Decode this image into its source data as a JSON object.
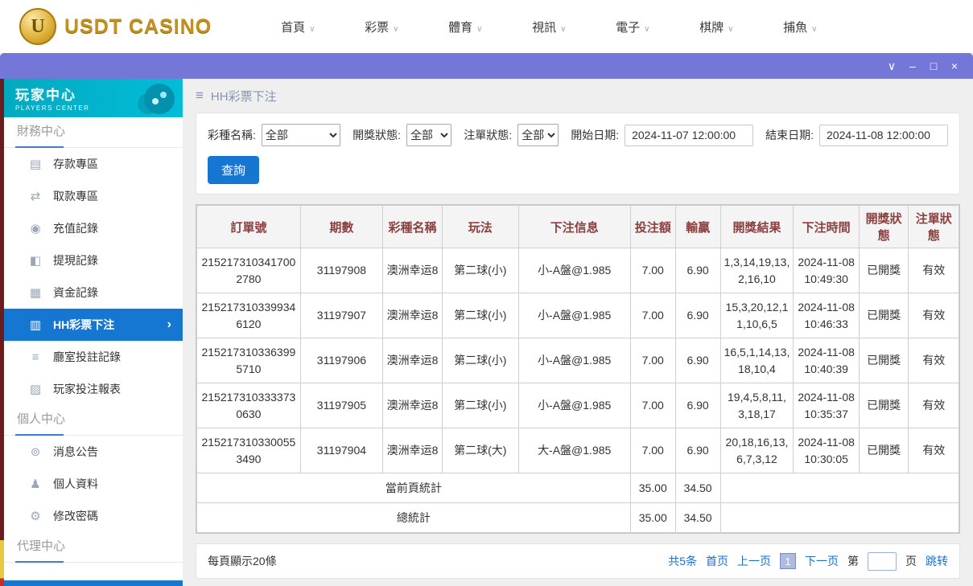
{
  "icons": {
    "nav_chevron": "∨",
    "window_restore": "∨",
    "window_minimize": "–",
    "window_maximize": "□",
    "window_close": "×",
    "hamburger": "≡",
    "active_chevron": "›"
  },
  "topnav": {
    "logo": {
      "text": "USDT CASINO",
      "badge_letter": "U"
    },
    "items": [
      {
        "label": "首頁"
      },
      {
        "label": "彩票"
      },
      {
        "label": "體育"
      },
      {
        "label": "視訊"
      },
      {
        "label": "電子"
      },
      {
        "label": "棋牌"
      },
      {
        "label": "捕魚"
      }
    ]
  },
  "sidebar": {
    "header": {
      "title": "玩家中心",
      "subtitle": "PLAYERS CENTER"
    },
    "sections": [
      {
        "label": "財務中心",
        "items": [
          {
            "label": "存款專區",
            "icon": "▤"
          },
          {
            "label": "取款專區",
            "icon": "⇄"
          },
          {
            "label": "充值記錄",
            "icon": "◉"
          },
          {
            "label": "提現記錄",
            "icon": "◧"
          },
          {
            "label": "資金記錄",
            "icon": "▦"
          },
          {
            "label": "HH彩票下注",
            "icon": "▥"
          },
          {
            "label": "廳室投註記錄",
            "icon": "≡"
          },
          {
            "label": "玩家投注報表",
            "icon": "▨"
          }
        ]
      },
      {
        "label": "個人中心",
        "items": [
          {
            "label": "消息公告",
            "icon": "⊚"
          },
          {
            "label": "個人資料",
            "icon": "♟"
          },
          {
            "label": "修改密碼",
            "icon": "⚙"
          }
        ]
      },
      {
        "label": "代理中心",
        "items": []
      }
    ]
  },
  "main": {
    "breadcrumb": "HH彩票下注",
    "filters": {
      "lottery_label": "彩種名稱:",
      "lottery_value": "全部",
      "draw_status_label": "開獎狀態:",
      "draw_status_value": "全部",
      "order_status_label": "注單狀態:",
      "order_status_value": "全部",
      "start_label": "開始日期:",
      "start_value": "2024-11-07 12:00:00",
      "end_label": "結束日期:",
      "end_value": "2024-11-08 12:00:00",
      "search_button": "查詢"
    },
    "table": {
      "headers": [
        "訂單號",
        "期數",
        "彩種名稱",
        "玩法",
        "下注信息",
        "投注額",
        "輸贏",
        "開獎結果",
        "下注時間",
        "開獎狀態",
        "注單狀態"
      ],
      "rows": [
        {
          "order_no": "2152173103417002780",
          "issue": "31197908",
          "lottery": "澳洲幸运8",
          "play": "第二球(小)",
          "bet_info": "小-A盤@1.985",
          "bet_amount": "7.00",
          "win_loss": "6.90",
          "result": "1,3,14,19,13,2,16,10",
          "bet_time": "2024-11-08 10:49:30",
          "draw_status": "已開獎",
          "order_status": "有效"
        },
        {
          "order_no": "2152173103399346120",
          "issue": "31197907",
          "lottery": "澳洲幸运8",
          "play": "第二球(小)",
          "bet_info": "小-A盤@1.985",
          "bet_amount": "7.00",
          "win_loss": "6.90",
          "result": "15,3,20,12,11,10,6,5",
          "bet_time": "2024-11-08 10:46:33",
          "draw_status": "已開獎",
          "order_status": "有效"
        },
        {
          "order_no": "2152173103363995710",
          "issue": "31197906",
          "lottery": "澳洲幸运8",
          "play": "第二球(小)",
          "bet_info": "小-A盤@1.985",
          "bet_amount": "7.00",
          "win_loss": "6.90",
          "result": "16,5,1,14,13,18,10,4",
          "bet_time": "2024-11-08 10:40:39",
          "draw_status": "已開獎",
          "order_status": "有效"
        },
        {
          "order_no": "2152173103333730630",
          "issue": "31197905",
          "lottery": "澳洲幸运8",
          "play": "第二球(小)",
          "bet_info": "小-A盤@1.985",
          "bet_amount": "7.00",
          "win_loss": "6.90",
          "result": "19,4,5,8,11,3,18,17",
          "bet_time": "2024-11-08 10:35:37",
          "draw_status": "已開獎",
          "order_status": "有效"
        },
        {
          "order_no": "2152173103300553490",
          "issue": "31197904",
          "lottery": "澳洲幸运8",
          "play": "第二球(大)",
          "bet_info": "大-A盤@1.985",
          "bet_amount": "7.00",
          "win_loss": "6.90",
          "result": "20,18,16,13,6,7,3,12",
          "bet_time": "2024-11-08 10:30:05",
          "draw_status": "已開獎",
          "order_status": "有效"
        }
      ],
      "page_summary_label": "當前頁統計",
      "page_summary_bet": "35.00",
      "page_summary_win": "34.50",
      "total_summary_label": "總統計",
      "total_summary_bet": "35.00",
      "total_summary_win": "34.50"
    },
    "pagination": {
      "page_size_text": "每頁顯示20條",
      "total_text": "共5条",
      "first": "首页",
      "prev": "上一页",
      "current": "1",
      "next": "下一页",
      "jump_prefix": "第",
      "jump_suffix": "页",
      "jump_button": "跳转"
    }
  },
  "colors": {
    "accent_blue": "#1677d2",
    "window_bar": "#7477d8",
    "sidebar_header_teal": "#03bcd9",
    "table_header_text": "#8b4040",
    "link_blue": "#1a6ec8",
    "logo_gold": "#c3921d"
  }
}
